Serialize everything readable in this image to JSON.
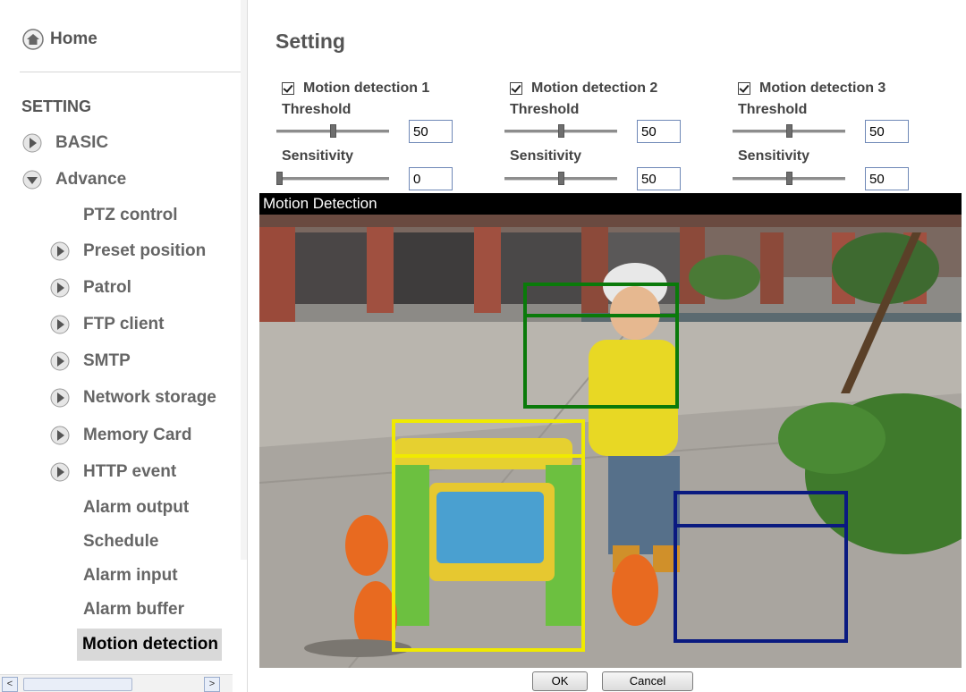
{
  "sidebar": {
    "home_label": "Home",
    "section_heading": "SETTING",
    "items": [
      {
        "label": "BASIC"
      },
      {
        "label": "Advance"
      },
      {
        "label": "PTZ control"
      },
      {
        "label": "Preset position"
      },
      {
        "label": "Patrol"
      },
      {
        "label": "FTP client"
      },
      {
        "label": "SMTP"
      },
      {
        "label": "Network storage"
      },
      {
        "label": "Memory Card"
      },
      {
        "label": "HTTP event"
      },
      {
        "label": "Alarm output"
      },
      {
        "label": "Schedule"
      },
      {
        "label": "Alarm input"
      },
      {
        "label": "Alarm buffer"
      },
      {
        "label": "Motion detection"
      }
    ],
    "scroll_arrows": {
      "left": "<",
      "right": ">"
    }
  },
  "main": {
    "title": "Setting",
    "threshold_label": "Threshold",
    "sensitivity_label": "Sensitivity",
    "zones": [
      {
        "label": "Motion detection 1",
        "checked": true,
        "threshold": "50",
        "sensitivity": "0",
        "color": "#0a7a0a"
      },
      {
        "label": "Motion detection 2",
        "checked": true,
        "threshold": "50",
        "sensitivity": "50",
        "color": "#e8e000"
      },
      {
        "label": "Motion detection 3",
        "checked": true,
        "threshold": "50",
        "sensitivity": "50",
        "color": "#0a1a8a"
      }
    ],
    "video_title": "Motion Detection",
    "ok_label": "OK",
    "cancel_label": "Cancel"
  },
  "colors": {
    "zone1": "#0a7a0a",
    "zone2": "#f0ea00",
    "zone3": "#0a1a80"
  }
}
